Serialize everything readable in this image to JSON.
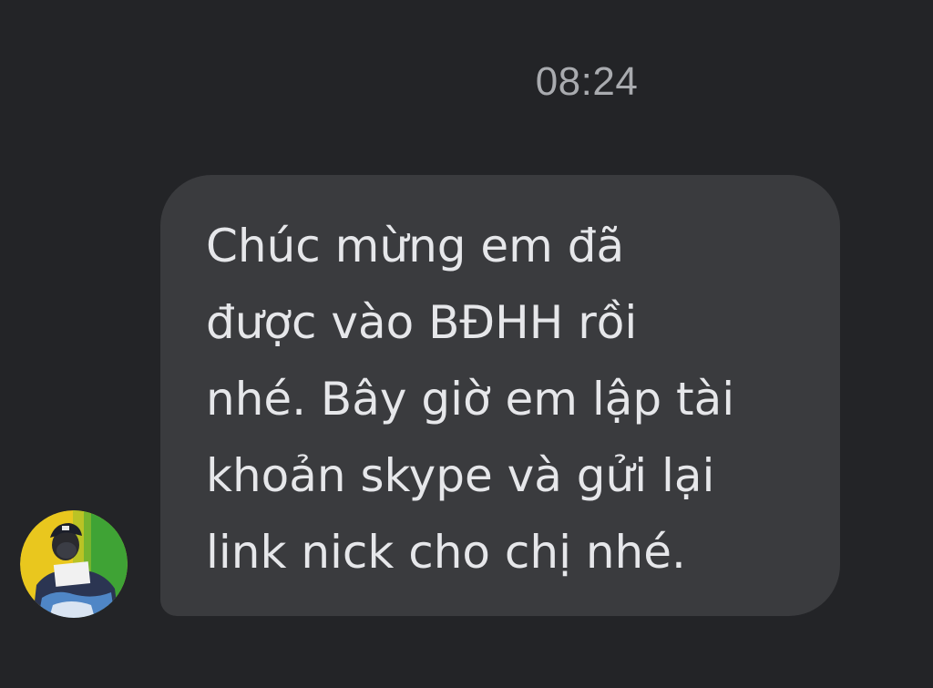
{
  "conversation": {
    "timestamp": "08:24",
    "message": {
      "text": "Chúc mừng em đã\nđược vào BĐHH rồi\nnhé. Bây giờ em lập tài\nkhoản skype và gửi lại\nlink nick cho chị nhé."
    },
    "sender": {
      "avatar_icon": "user-avatar-photo"
    }
  },
  "colors": {
    "background": "#232427",
    "bubble": "#3a3b3e",
    "message_text": "#e6e7ea",
    "timestamp_text": "#a9abaf"
  }
}
